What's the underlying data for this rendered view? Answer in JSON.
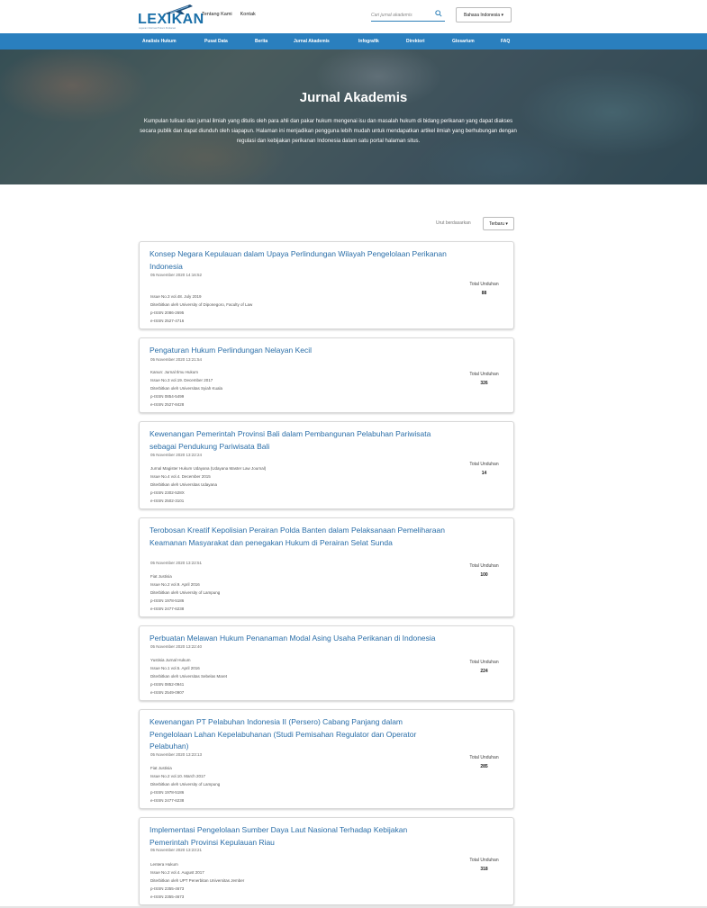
{
  "header": {
    "logo_text": "LEXIKAN",
    "logo_tagline": "Layanan Informasi Hukum Perikanan",
    "links": [
      "Tentang Kami",
      "Kontak"
    ],
    "search_placeholder": "Cari jurnal akademis",
    "language": "Bahasa Indonesia ▾"
  },
  "nav": [
    "Analisis Hukum",
    "Pusat Data",
    "Berita",
    "Jurnal Akademis",
    "Infografik",
    "Direktori",
    "Glosarium",
    "FAQ"
  ],
  "hero": {
    "title": "Jurnal Akademis",
    "description": "Kumpulan tulisan dan jurnal ilmiah yang ditulis oleh para ahli dan pakar hukum mengenai isu dan masalah hukum di bidang perikanan yang dapat diakses secara publik dan dapat diunduh oleh siapapun. Halaman ini menjadikan pengguna lebih mudah untuk mendapatkan artikel ilmiah yang berhubungan dengan regulasi dan kebijakan perikanan Indonesia dalam satu portal halaman situs."
  },
  "sort": {
    "label": "Urut berdasarkan",
    "value": "Terbaru ▾"
  },
  "stat_label": "Total Unduhan",
  "articles": [
    {
      "title": "Konsep Negara Kepulauan dalam Upaya Perlindungan Wilayah Pengelolaan Perikanan Indonesia",
      "date": "05 November 2020 14:16:52",
      "meta": [
        "Issue No.3 vol.48. July 2019",
        "Diterbitkan oleh University of Diponegoro, Faculty of Law",
        "p-ISSN 2086-2695",
        "e-ISSN 2527-4716"
      ],
      "downloads": "88"
    },
    {
      "title": "Pengaturan Hukum Perlindungan Nelayan Kecil",
      "date": "05 November 2020 13:21:54",
      "meta": [
        "Kanun: Jurnal Ilmu Hukum",
        "Issue No.3 vol.19. December 2017",
        "Diterbitkan oleh Universitas Syiah Kuala",
        "p-ISSN 0854-5499",
        "e-ISSN 2527-8428"
      ],
      "downloads": "326"
    },
    {
      "title": "Kewenangan Pemerintah Provinsi Bali dalam Pembangunan Pelabuhan Pariwisata sebagai Pendukung Pariwisata Bali",
      "date": "05 November 2020 13:22:24",
      "meta": [
        "Jurnal Magister Hukum Udayana (Udayana Master Law Journal)",
        "Issue No.4 vol.4. December 2015",
        "Diterbitkan oleh Universitas Udayana",
        "p-ISSN 2302-528X",
        "e-ISSN 2502-3101"
      ],
      "downloads": "14"
    },
    {
      "title": "Terobosan Kreatif Kepolisian Perairan Polda Banten dalam Pelaksanaan Pemeliharaan Keamanan Masyarakat dan penegakan Hukum di Perairan Selat Sunda",
      "date": "05 November 2020 13:22:51",
      "meta": [
        "Fiat Justisia",
        "Issue No.2 vol.9. April 2016",
        "Diterbitkan oleh University of Lampung",
        "p-ISSN 1978-5186",
        "e-ISSN 2477-6238"
      ],
      "downloads": "100"
    },
    {
      "title": "Perbuatan Melawan Hukum Penanaman Modal Asing Usaha Perikanan di Indonesia",
      "date": "05 November 2020 13:22:40",
      "meta": [
        "Yustisia Jurnal Hukum",
        "Issue No.1 vol.5. April 2016",
        "Diterbitkan oleh Universitas Sebelas Maret",
        "p-ISSN 0852-0941",
        "e-ISSN 2549-0907"
      ],
      "downloads": "224"
    },
    {
      "title": "Kewenangan PT Pelabuhan Indonesia II (Persero) Cabang Panjang dalam Pengelolaan Lahan Kepelabuhanan (Studi Pemisahan Regulator dan Operator Pelabuhan)",
      "date": "05 November 2020 13:23:13",
      "meta": [
        "Fiat Justisia",
        "Issue No.2 vol.10. March 2017",
        "Diterbitkan oleh University of Lampung",
        "p-ISSN 1978-5186",
        "e-ISSN 2477-6238"
      ],
      "downloads": "285"
    },
    {
      "title": "Implementasi Pengelolaan Sumber Daya Laut Nasional Terhadap Kebijakan Pemerintah Provinsi Kepulauan Riau",
      "date": "05 November 2020 13:23:21",
      "meta": [
        "Lentera Hukum",
        "Issue No.2 vol.4. August 2017",
        "Diterbitkan oleh UPT Penerbitan Universitas Jember",
        "p-ISSN 2355-4673",
        "e-ISSN 2355-4673"
      ],
      "downloads": "318"
    }
  ],
  "colors": {
    "brand": "#2a7fbe",
    "link": "#2a6ea8"
  }
}
